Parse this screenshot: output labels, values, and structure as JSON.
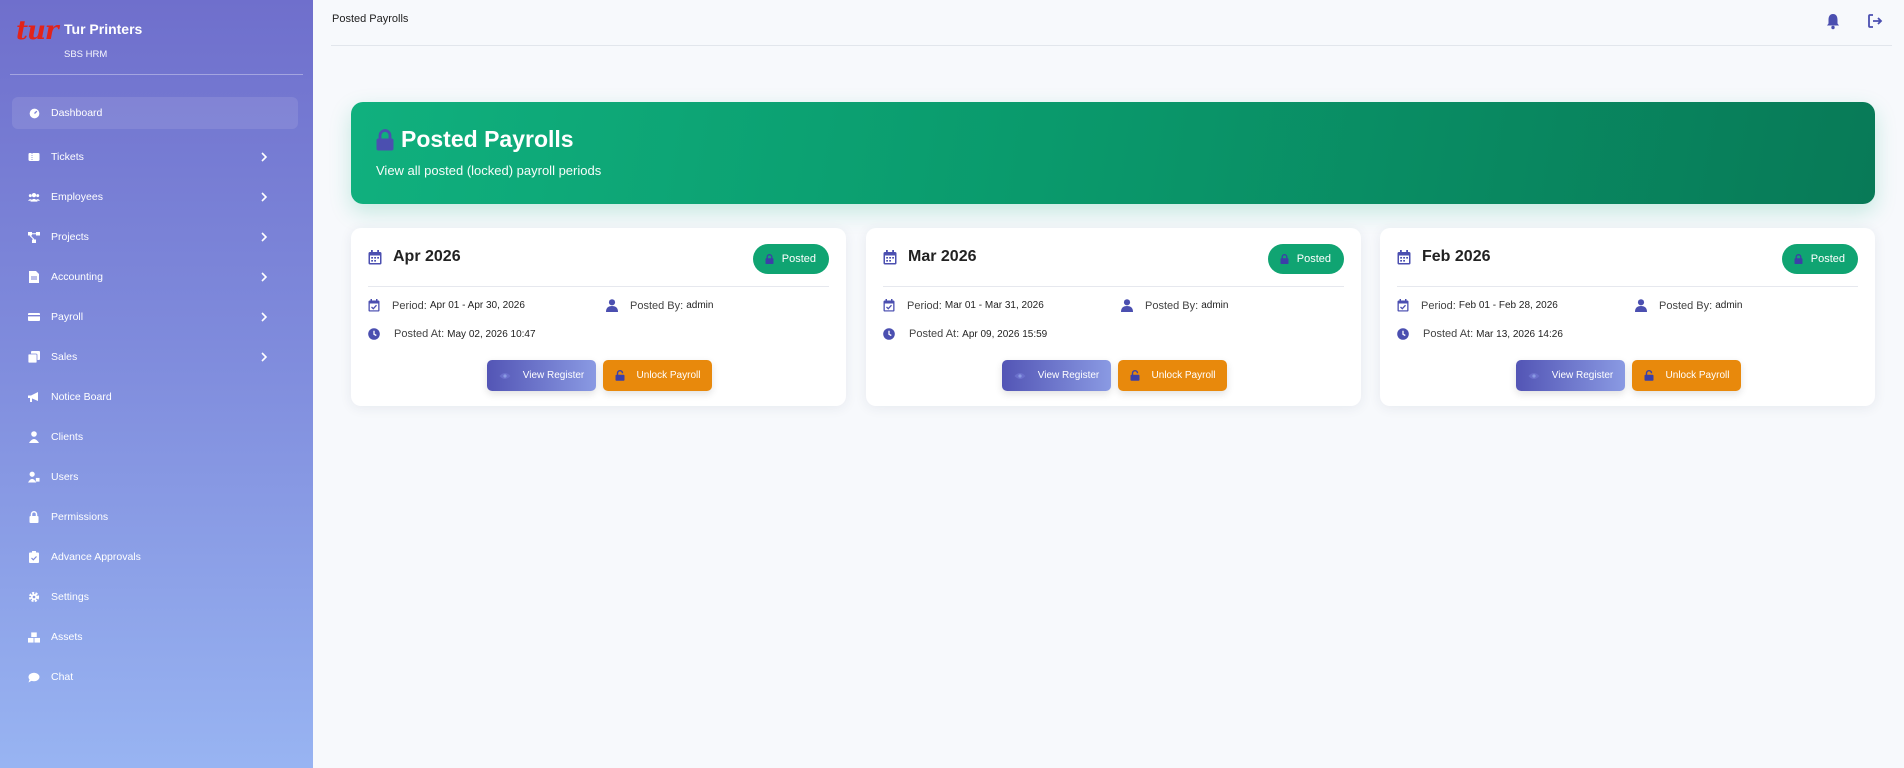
{
  "brand": {
    "logo_text": "tur",
    "name": "Tur Printers",
    "subtitle": "SBS HRM"
  },
  "sidebar": {
    "items": [
      {
        "label": "Dashboard",
        "icon": "dashboard-icon",
        "has_submenu": false,
        "active": true
      },
      {
        "label": "Tickets",
        "icon": "ticket-icon",
        "has_submenu": true
      },
      {
        "label": "Employees",
        "icon": "users-icon",
        "has_submenu": true
      },
      {
        "label": "Projects",
        "icon": "project-diagram-icon",
        "has_submenu": true
      },
      {
        "label": "Accounting",
        "icon": "file-invoice-icon",
        "has_submenu": true
      },
      {
        "label": "Payroll",
        "icon": "money-card-icon",
        "has_submenu": true
      },
      {
        "label": "Sales",
        "icon": "copy-icon",
        "has_submenu": true
      },
      {
        "label": "Notice Board",
        "icon": "megaphone-icon",
        "has_submenu": false
      },
      {
        "label": "Clients",
        "icon": "user-icon",
        "has_submenu": false
      },
      {
        "label": "Users",
        "icon": "user-lock-icon",
        "has_submenu": false
      },
      {
        "label": "Permissions",
        "icon": "lock-icon",
        "has_submenu": false
      },
      {
        "label": "Advance Approvals",
        "icon": "clipboard-check-icon",
        "has_submenu": false
      },
      {
        "label": "Settings",
        "icon": "gear-icon",
        "has_submenu": false
      },
      {
        "label": "Assets",
        "icon": "boxes-icon",
        "has_submenu": false
      },
      {
        "label": "Chat",
        "icon": "chat-icon",
        "has_submenu": false
      }
    ]
  },
  "topbar": {
    "title": "Posted Payrolls"
  },
  "banner": {
    "title": "Posted Payrolls",
    "subtitle": "View all posted (locked) payroll periods"
  },
  "labels": {
    "period": "Period:",
    "posted_by": "Posted By:",
    "posted_at": "Posted At:",
    "view_register": "View Register",
    "unlock_payroll": "Unlock Payroll"
  },
  "cards": [
    {
      "title": "Apr 2026",
      "status": "Posted",
      "period": "Apr 01 - Apr 30, 2026",
      "posted_by": "admin",
      "posted_at": "May 02, 2026 10:47"
    },
    {
      "title": "Mar 2026",
      "status": "Posted",
      "period": "Mar 01 - Mar 31, 2026",
      "posted_by": "admin",
      "posted_at": "Apr 09, 2026 15:59"
    },
    {
      "title": "Feb 2026",
      "status": "Posted",
      "period": "Feb 01 - Feb 28, 2026",
      "posted_by": "admin",
      "posted_at": "Mar 13, 2026 14:26"
    }
  ],
  "colors": {
    "accent": "#5355b5",
    "success": "#10a472",
    "warning": "#e8890c",
    "brand_red": "#e2231a"
  }
}
